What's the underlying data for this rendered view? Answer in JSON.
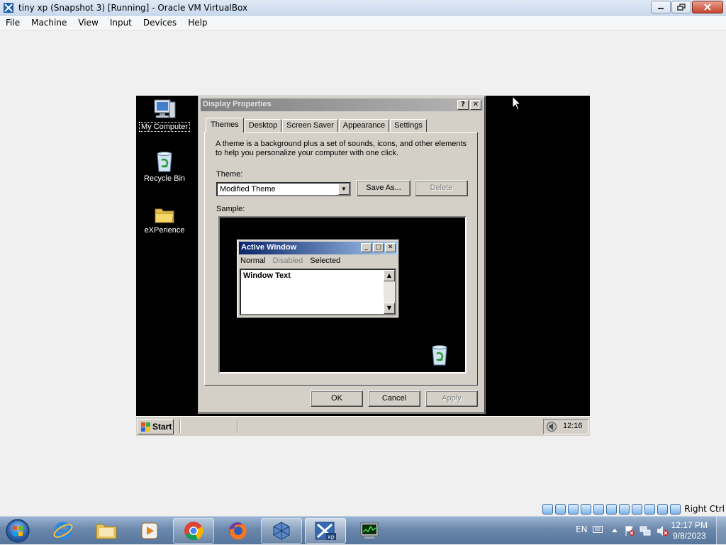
{
  "host": {
    "title": "tiny xp (Snapshot 3) [Running] - Oracle VM VirtualBox",
    "menu": [
      "File",
      "Machine",
      "View",
      "Input",
      "Devices",
      "Help"
    ],
    "status_label": "Right Ctrl"
  },
  "guest": {
    "desktop_icons": [
      "My Computer",
      "Recycle Bin",
      "eXPerience"
    ],
    "dialog": {
      "title": "Display Properties",
      "help_btn": "?",
      "close_btn": "✕",
      "tabs": [
        "Themes",
        "Desktop",
        "Screen Saver",
        "Appearance",
        "Settings"
      ],
      "description": "A theme is a background plus a set of sounds, icons, and other elements to help you personalize your computer with one click.",
      "theme_label": "Theme:",
      "theme_value": "Modified Theme",
      "save_as": "Save As...",
      "delete": "Delete",
      "sample_label": "Sample:",
      "sample": {
        "title": "Active Window",
        "menu": [
          "Normal",
          "Disabled",
          "Selected"
        ],
        "text": "Window Text"
      },
      "ok": "OK",
      "cancel": "Cancel",
      "apply": "Apply"
    },
    "taskbar": {
      "start": "Start",
      "clock": "12:16"
    }
  },
  "win7": {
    "language": "EN",
    "time": "12:17 PM",
    "date": "9/8/2023"
  }
}
